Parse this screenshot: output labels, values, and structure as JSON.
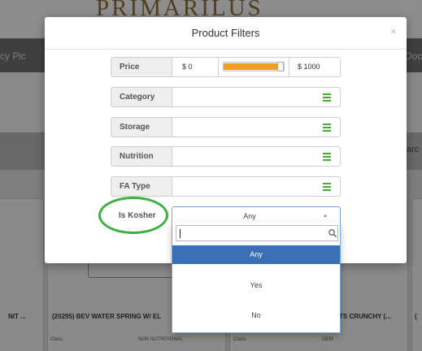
{
  "background": {
    "logo_text": "PRIMARILUS",
    "nav_left_text": "cy Pic",
    "nav_right_text": "Doc",
    "toolbar_right_text": "arc",
    "cards": [
      {
        "title": "NIT ...",
        "sub_left": "",
        "sub_right": ""
      },
      {
        "title": "(20295) BEV WATER SPRING W/ EL",
        "sub_left": "Class",
        "sub_right": "NON NUTRITIONAL"
      },
      {
        "title": "TS CRUNCHY (...",
        "sub_left": "Class",
        "sub_right": "OEM"
      },
      {
        "title": "(",
        "sub_left": "",
        "sub_right": ""
      }
    ]
  },
  "modal": {
    "title": "Product Filters",
    "close_symbol": "×",
    "filters": {
      "price": {
        "label": "Price",
        "min_value": "$ 0",
        "max_value": "$ 1000",
        "range_fill_fraction": [
          0.0,
          1.0
        ]
      },
      "category": {
        "label": "Category"
      },
      "storage": {
        "label": "Storage"
      },
      "nutrition": {
        "label": "Nutrition"
      },
      "fa_type": {
        "label": "FA Type"
      },
      "is_kosher": {
        "label": "Is Kosher",
        "selected_value": "Any",
        "arrow_symbol": "▲"
      }
    }
  },
  "dropdown": {
    "search_value": "",
    "options": [
      {
        "label": "Any",
        "selected": true
      },
      {
        "label": "Yes",
        "selected": false
      },
      {
        "label": "No",
        "selected": false
      }
    ]
  },
  "colors": {
    "accent_orange": "#f0a020",
    "menu_icon_green": "#4da63a",
    "annotation_green": "#3cb043",
    "selected_blue": "#3b6fb6",
    "focus_blue": "#6fa8dc"
  }
}
